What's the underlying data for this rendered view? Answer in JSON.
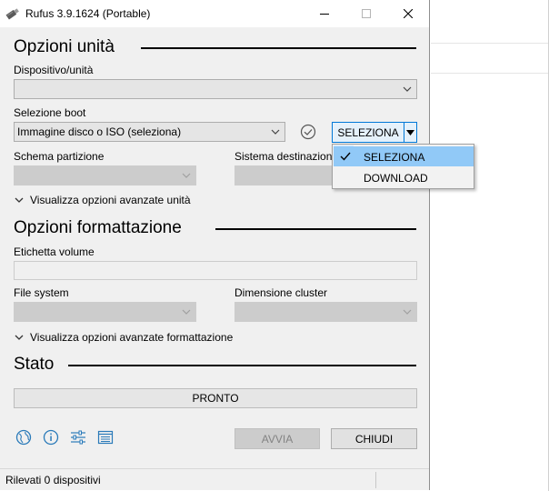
{
  "window": {
    "title": "Rufus 3.9.1624 (Portable)"
  },
  "drive_section": {
    "heading": "Opzioni unità",
    "device_label": "Dispositivo/unità",
    "device_value": "",
    "boot_label": "Selezione boot",
    "boot_value": "Immagine disco o ISO (seleziona)",
    "select_button": "SELEZIONA",
    "partition_label": "Schema partizione",
    "target_label": "Sistema destinazione",
    "advanced_toggle": "Visualizza opzioni avanzate unità"
  },
  "select_menu": {
    "items": [
      "SELEZIONA",
      "DOWNLOAD"
    ],
    "checked": "SELEZIONA"
  },
  "format_section": {
    "heading": "Opzioni formattazione",
    "volume_label": "Etichetta volume",
    "volume_value": "",
    "filesystem_label": "File system",
    "cluster_label": "Dimensione cluster",
    "advanced_toggle": "Visualizza opzioni avanzate formattazione"
  },
  "status_section": {
    "heading": "Stato",
    "progress_text": "PRONTO",
    "progress_fraction": 0
  },
  "toolbar": {
    "icons": [
      "globe-icon",
      "info-icon",
      "settings-sliders-icon",
      "log-icon"
    ],
    "start_button": "AVVIA",
    "close_button": "CHIUDI"
  },
  "statusbar": {
    "text": "Rilevati 0 dispositivi"
  },
  "colors": {
    "accent": "#0078d7",
    "menu_highlight": "#91c9f7",
    "window_bg": "#f0f0f0",
    "icon_blue": "#2a7ab9"
  }
}
